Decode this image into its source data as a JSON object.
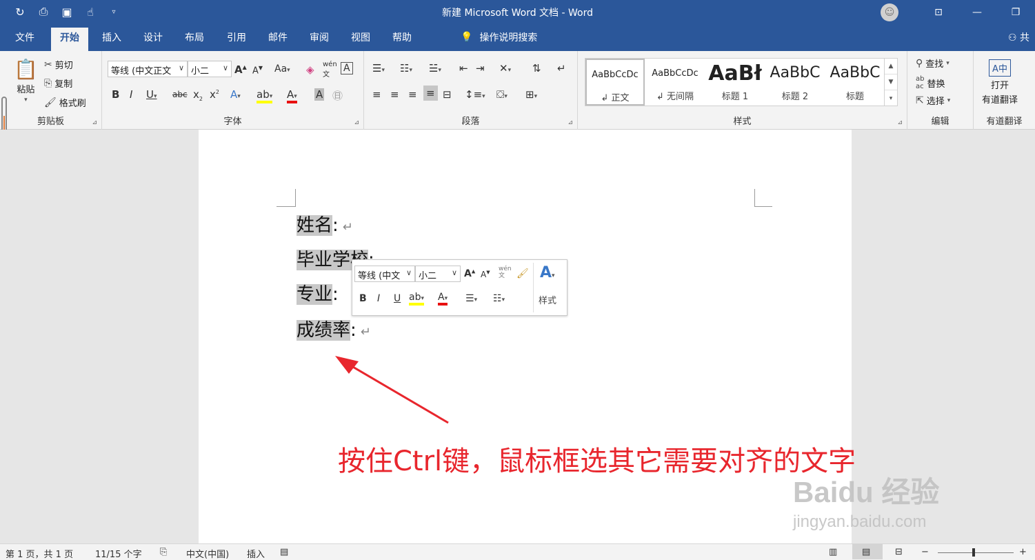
{
  "titlebar": {
    "doc_title": "新建 Microsoft Word 文档  -  Word",
    "qat_icons": [
      "redo-icon",
      "print-preview-icon",
      "save-icon",
      "touch-mode-icon",
      "customize-qat-icon"
    ]
  },
  "menu": {
    "tabs": [
      "文件",
      "开始",
      "插入",
      "设计",
      "布局",
      "引用",
      "邮件",
      "审阅",
      "视图",
      "帮助"
    ],
    "tellme": "操作说明搜索",
    "share": "共"
  },
  "clipboard": {
    "paste": "粘贴",
    "cut": "剪切",
    "copy": "复制",
    "format_painter": "格式刷",
    "label": "剪贴板"
  },
  "font": {
    "name": "等线 (中文正文",
    "size": "小二",
    "label": "字体",
    "case": "Aa",
    "phonetic": "wén"
  },
  "paragraph": {
    "label": "段落"
  },
  "styles": {
    "items": [
      {
        "sample": "AaBbCcDc",
        "name": "↲ 正文"
      },
      {
        "sample": "AaBbCcDc",
        "name": "↲ 无间隔"
      },
      {
        "sample": "AaBł",
        "name": "标题 1"
      },
      {
        "sample": "AaBbC",
        "name": "标题 2"
      },
      {
        "sample": "AaBbC",
        "name": "标题"
      }
    ],
    "label": "样式"
  },
  "editing": {
    "find": "查找",
    "replace": "替换",
    "select": "选择",
    "label": "编辑"
  },
  "youdao": {
    "open": "打开",
    "translate": "有道翻译",
    "label": "有道翻译"
  },
  "document": {
    "lines": [
      {
        "text": "姓名",
        "colon": ":"
      },
      {
        "text": "毕业学校",
        "colon": ":"
      },
      {
        "text": "专业",
        "colon": ":"
      },
      {
        "text": "成绩率",
        "colon": ":"
      }
    ],
    "para_mark": "↵"
  },
  "mini_toolbar": {
    "font": "等线 (中文",
    "size": "小二",
    "styles": "样式",
    "phonetic": "wén"
  },
  "annotation": "按住Ctrl键，鼠标框选其它需要对齐的文字",
  "watermark": {
    "brand": "Baidu 经验",
    "url": "jingyan.baidu.com"
  },
  "status": {
    "page": "第 1 页，共 1 页",
    "words": "11/15 个字",
    "language": "中文(中国)",
    "mode": "插入"
  },
  "colors": {
    "accent": "#2b579a",
    "annotation": "#e8262d",
    "selection": "#c8c8c8"
  }
}
